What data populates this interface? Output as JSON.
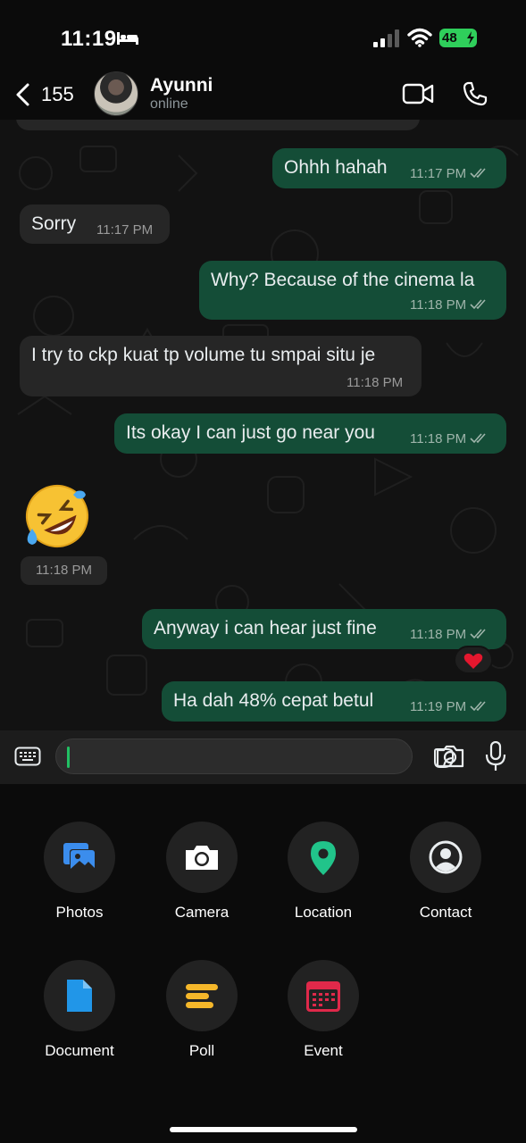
{
  "status_bar": {
    "time": "11:19",
    "battery": "48",
    "icons": [
      "bed-icon",
      "signal-icon",
      "wifi-icon",
      "battery-charging-icon"
    ]
  },
  "header": {
    "back_count": "155",
    "contact_name": "Ayunni",
    "contact_status": "online",
    "icons": [
      "back-chevron-icon",
      "video-call-icon",
      "voice-call-icon"
    ]
  },
  "messages": [
    {
      "direction": "out",
      "text": "Ohhh hahah",
      "time": "11:17 PM",
      "read": true
    },
    {
      "direction": "in",
      "text": "Sorry",
      "time": "11:17 PM"
    },
    {
      "direction": "out",
      "text": "Why? Because of the cinema la",
      "time": "11:18 PM",
      "read": true
    },
    {
      "direction": "in",
      "text": "I try to ckp kuat tp volume tu smpai situ je",
      "time": "11:18 PM"
    },
    {
      "direction": "out",
      "text": "Its okay I can just go near you",
      "time": "11:18 PM",
      "read": true
    },
    {
      "direction": "in",
      "emoji": "rolling-on-floor-laughing",
      "time": "11:18 PM"
    },
    {
      "direction": "out",
      "text": "Anyway i can hear just fine",
      "time": "11:18 PM",
      "read": true,
      "reaction": "red-heart"
    },
    {
      "direction": "out",
      "text": "Ha dah 48% cepat betul",
      "time": "11:19 PM",
      "read": true
    }
  ],
  "composer": {
    "value": "",
    "icons": [
      "keyboard-icon",
      "sticker-icon",
      "camera-icon",
      "microphone-icon"
    ]
  },
  "attachments": [
    {
      "label": "Photos",
      "icon": "photos-icon",
      "color": "#3b8ded"
    },
    {
      "label": "Camera",
      "icon": "camera-icon",
      "color": "#ffffff"
    },
    {
      "label": "Location",
      "icon": "location-pin-icon",
      "color": "#21c48a"
    },
    {
      "label": "Contact",
      "icon": "contact-icon",
      "color": "#e9edef"
    },
    {
      "label": "Document",
      "icon": "document-icon",
      "color": "#2196e8"
    },
    {
      "label": "Poll",
      "icon": "poll-icon",
      "color": "#f5b72a"
    },
    {
      "label": "Event",
      "icon": "calendar-event-icon",
      "color": "#e0294a"
    }
  ],
  "colors": {
    "incoming_bubble": "#262626",
    "outgoing_bubble": "#144d37",
    "accent_green": "#21c063"
  }
}
